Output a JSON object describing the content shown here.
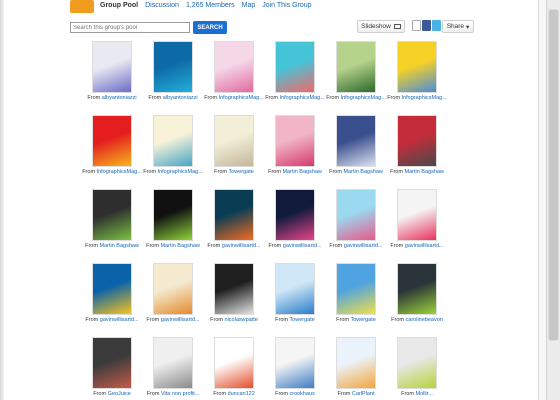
{
  "nav": {
    "group_pool": "Group Pool",
    "discussion": "Discussion",
    "members": "1,265 Members",
    "map": "Map",
    "join": "Join This Group"
  },
  "search": {
    "placeholder": "Search this group's pool",
    "button": "SEARCH"
  },
  "toolbar": {
    "slideshow": "Slideshow",
    "share": "Share"
  },
  "grid": [
    {
      "from": "From",
      "author": "albyantoniazzi",
      "colors": [
        "#e9e9f2",
        "#6c6cc8"
      ]
    },
    {
      "from": "From",
      "author": "albyantoniazzi",
      "colors": [
        "#0e6aa7",
        "#22b0d8"
      ]
    },
    {
      "from": "From",
      "author": "InfographicsMag...",
      "colors": [
        "#f4d8e8",
        "#e26aa0"
      ]
    },
    {
      "from": "From",
      "author": "InfographicsMag...",
      "colors": [
        "#45c4d8",
        "#f06a6a"
      ]
    },
    {
      "from": "From",
      "author": "InfographicsMag...",
      "colors": [
        "#b6d38b",
        "#2d6a2c"
      ]
    },
    {
      "from": "From",
      "author": "InfographicsMag...",
      "colors": [
        "#f7d226",
        "#4b8cd8"
      ]
    },
    {
      "from": "From",
      "author": "InfographicsMag...",
      "colors": [
        "#e41e1e",
        "#f7b71c"
      ]
    },
    {
      "from": "From",
      "author": "InfographicsMag...",
      "colors": [
        "#f7f2d8",
        "#48a6c8"
      ]
    },
    {
      "from": "From",
      "author": "Towergate",
      "colors": [
        "#f3eed8",
        "#c2b79a"
      ]
    },
    {
      "from": "From",
      "author": "Martin Bagshaw",
      "colors": [
        "#f1b5c6",
        "#d53a6d"
      ]
    },
    {
      "from": "From",
      "author": "Martin Bagshaw",
      "colors": [
        "#3a4f8d",
        "#dbe0f1"
      ]
    },
    {
      "from": "From",
      "author": "Martin Bagshaw",
      "colors": [
        "#c42c3b",
        "#4a4a4a"
      ]
    },
    {
      "from": "From",
      "author": "Martin Bagshaw",
      "colors": [
        "#2e2e2e",
        "#7ac143"
      ]
    },
    {
      "from": "From",
      "author": "Martin Bagshaw",
      "colors": [
        "#111111",
        "#8fd33a"
      ]
    },
    {
      "from": "From",
      "author": "gavinwillisartd...",
      "colors": [
        "#0a3d54",
        "#f36c21"
      ]
    },
    {
      "from": "From",
      "author": "gavinwillisartd...",
      "colors": [
        "#101b3c",
        "#e8448c"
      ]
    },
    {
      "from": "From",
      "author": "gavinwillisartd...",
      "colors": [
        "#9ad9f0",
        "#e85a8a"
      ]
    },
    {
      "from": "From",
      "author": "gavinwillisartd...",
      "colors": [
        "#f4f4f4",
        "#e8325c"
      ]
    },
    {
      "from": "From",
      "author": "gavinwillisartd...",
      "colors": [
        "#0a63a8",
        "#f7c41c"
      ]
    },
    {
      "from": "From",
      "author": "gavinwillisartd...",
      "colors": [
        "#f5ead0",
        "#e38b2e"
      ]
    },
    {
      "from": "From",
      "author": "nicolaswpatte",
      "colors": [
        "#1f1f1f",
        "#e3e3e3"
      ]
    },
    {
      "from": "From",
      "author": "Towergate",
      "colors": [
        "#cfe7f6",
        "#2a7ec9"
      ]
    },
    {
      "from": "From",
      "author": "Towergate",
      "colors": [
        "#4fa3e0",
        "#f0e04a"
      ]
    },
    {
      "from": "From",
      "author": "carolinebeavon",
      "colors": [
        "#2a3338",
        "#9ad33a"
      ]
    },
    {
      "from": "From",
      "author": "GeoJuice",
      "colors": [
        "#3b3b3b",
        "#c45a4a"
      ]
    },
    {
      "from": "From",
      "author": "Vita non profit...",
      "colors": [
        "#efefef",
        "#8a8a8a"
      ]
    },
    {
      "from": "From",
      "author": "duncan122",
      "colors": [
        "#ffffff",
        "#e44e2c"
      ]
    },
    {
      "from": "From",
      "author": "crookhaus",
      "colors": [
        "#f5f5f5",
        "#3f7dc4"
      ]
    },
    {
      "from": "From",
      "author": "CarlPlant",
      "colors": [
        "#eaf3fb",
        "#f3a53b"
      ]
    },
    {
      "from": "From",
      "author": "Mollir...",
      "colors": [
        "#e8e8e8",
        "#b5d33a"
      ]
    }
  ]
}
